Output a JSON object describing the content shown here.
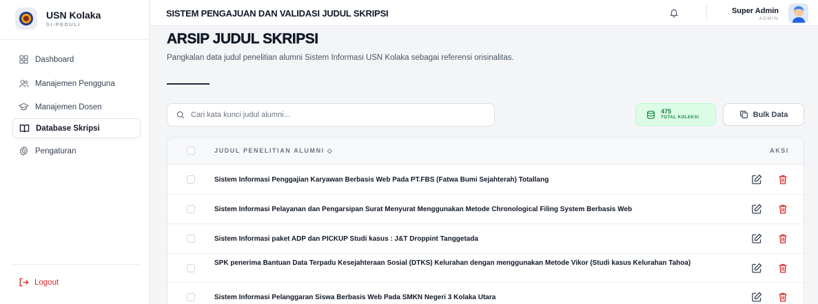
{
  "brand": {
    "name": "USN Kolaka",
    "subtitle": "SI-PEDULI"
  },
  "sidebar": {
    "items": [
      {
        "label": "Dashboard",
        "icon": "dashboard-icon",
        "active": false
      },
      {
        "label": "Manajemen Pengguna",
        "icon": "users-icon",
        "active": false
      },
      {
        "label": "Manajemen Dosen",
        "icon": "graduation-cap-icon",
        "active": false
      },
      {
        "label": "Database Skripsi",
        "icon": "book-open-icon",
        "active": true
      },
      {
        "label": "Pengaturan",
        "icon": "gear-icon",
        "active": false
      }
    ],
    "logout_label": "Logout"
  },
  "header": {
    "title": "SISTEM PENGAJUAN DAN VALIDASI JUDUL SKRIPSI",
    "user_name": "Super Admin",
    "user_role": "ADMIN"
  },
  "main": {
    "title": "ARSIP JUDUL SKRIPSI",
    "description": "Pangkalan data judul penelitian alumni Sistem Informasi USN Kolaka sebagai referensi orisinalitas.",
    "search_placeholder": "Cari kata kunci judul alumni...",
    "total_count": "475",
    "total_label": "TOTAL KOLEKSI",
    "bulk_label": "Bulk Data"
  },
  "table": {
    "col_title": "JUDUL PENELITIAN ALUMNI ◇",
    "col_action": "AKSI",
    "rows": [
      "Sistem Informasi Penggajian Karyawan Berbasis Web Pada PT.FBS (Fatwa Bumi Sejahterah) Totallang",
      "Sistem Informasi Pelayanan dan Pengarsipan Surat Menyurat Menggunakan Metode Chronological Filing System Berbasis Web",
      "Sistem Informasi paket ADP dan PICKUP Studi kasus : J&T Droppint Tanggetada",
      "SPK penerima Bantuan Data Terpadu Kesejahteraan Sosial (DTKS) Kelurahan dengan menggunakan Metode Vikor (Studi kasus Kelurahan Tahoa)",
      "Sistem Informasi Pelanggaran Siswa Berbasis Web Pada SMKN Negeri 3 Kolaka Utara"
    ]
  },
  "colors": {
    "accent_green": "#15803d",
    "danger": "#dc2626",
    "text_dark": "#111827"
  }
}
